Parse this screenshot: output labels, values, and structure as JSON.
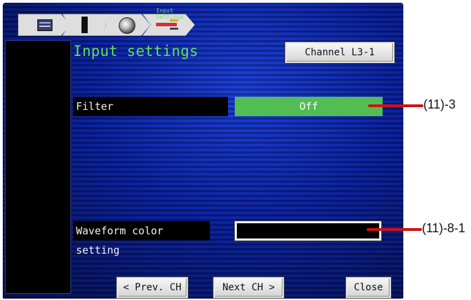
{
  "toolbar": {
    "caption": "Input settings",
    "icons": [
      "monitor-icon",
      "meter-icon",
      "dial-icon",
      "probe-icon"
    ]
  },
  "main": {
    "title": "Input settings",
    "channel_button": "Channel L3-1",
    "filter": {
      "label": "Filter",
      "value": "Off"
    },
    "waveform_color": {
      "label": "Waveform color setting",
      "color": "#000000"
    }
  },
  "footer": {
    "prev_label": "< Prev. CH",
    "next_label": "Next CH >",
    "close_label": "Close"
  },
  "callouts": {
    "filter": "(11)-3",
    "waveform_color": "(11)-8-1"
  },
  "colors": {
    "title": "#5fe05f",
    "selected_value": "#52bd52",
    "callout_line": "#d11111"
  }
}
